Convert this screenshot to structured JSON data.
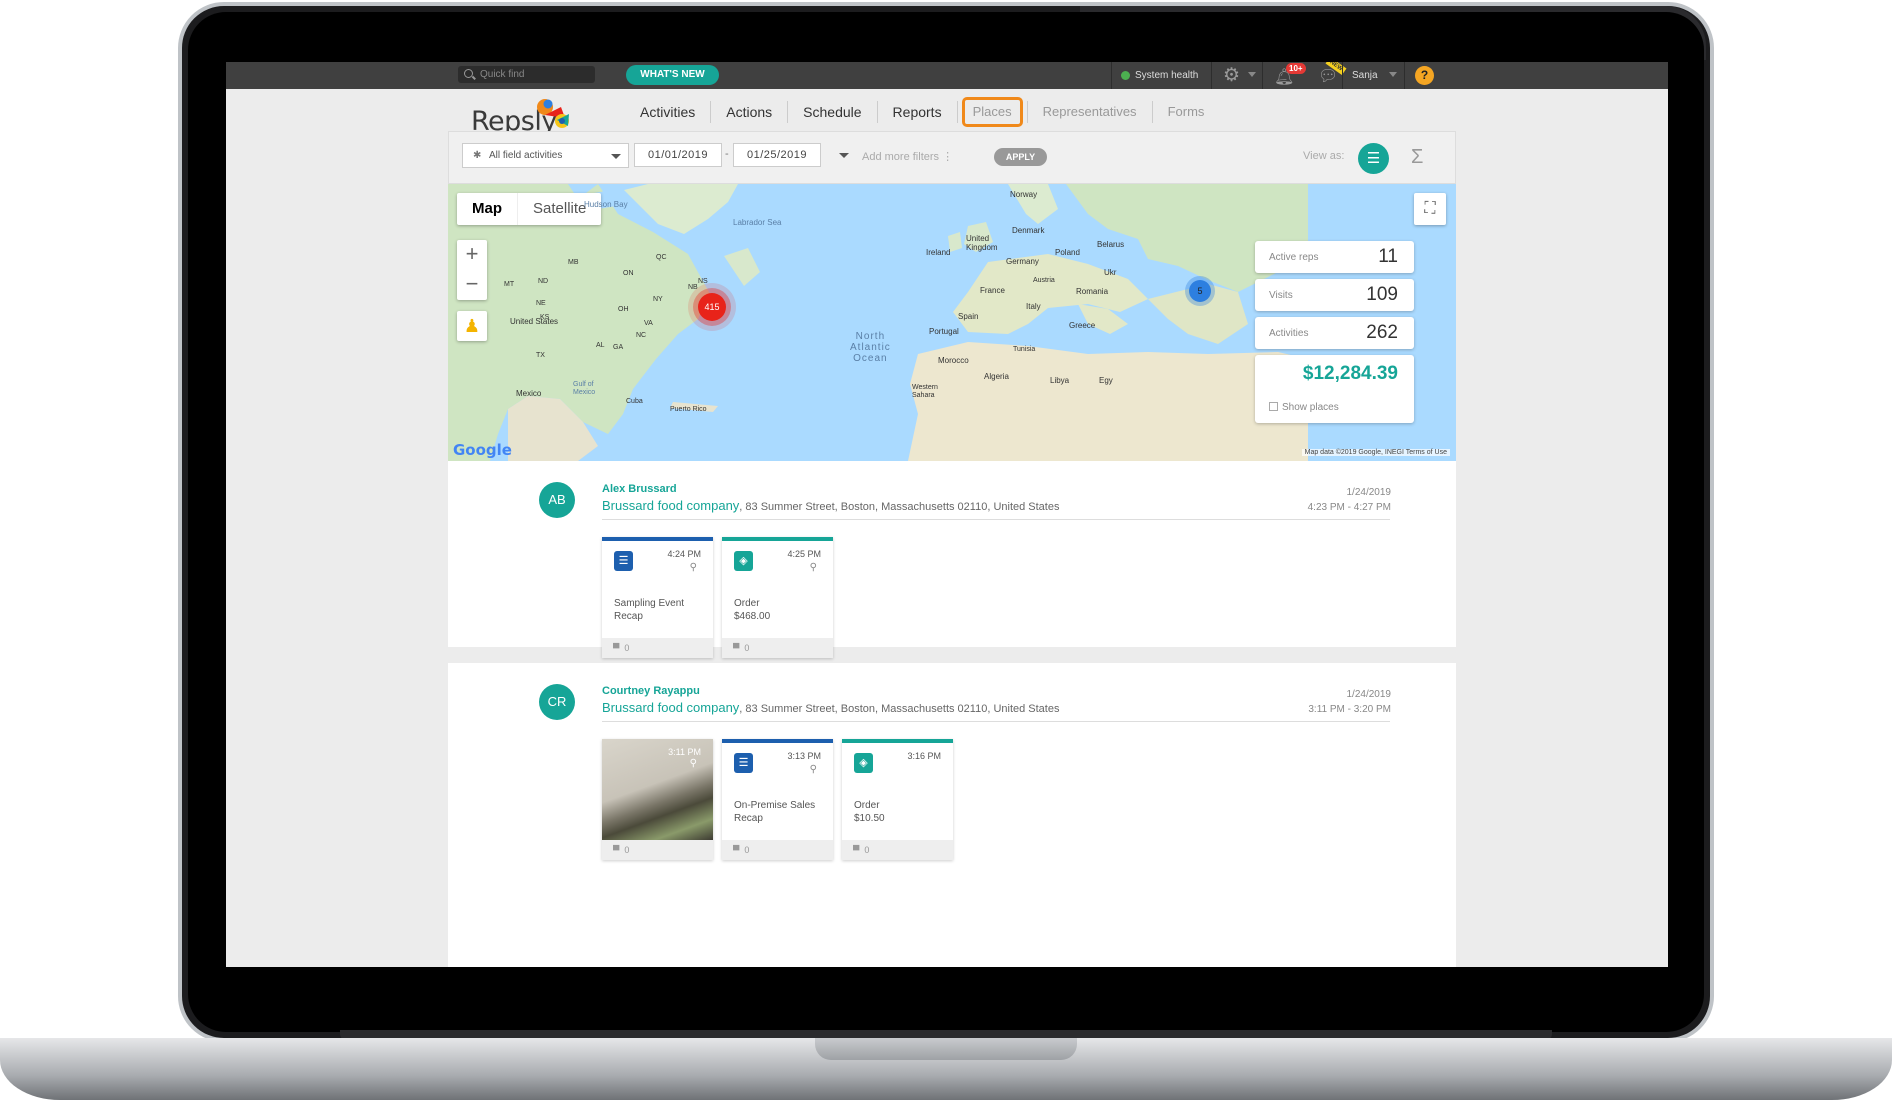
{
  "topbar": {
    "quick_find_placeholder": "Quick find",
    "whats_new": "WHAT'S NEW",
    "system_health": "System health",
    "notifications_badge": "10+",
    "new_tag": "NEW",
    "user_name": "Sanja",
    "help_label": "?"
  },
  "logo": {
    "text": "Repsly"
  },
  "nav": {
    "items": [
      "Activities",
      "Actions",
      "Schedule",
      "Reports",
      "Places",
      "Representatives",
      "Forms"
    ]
  },
  "filters": {
    "activity_type": "All field activities",
    "date_from": "01/01/2019",
    "date_separator": "-",
    "date_to": "01/25/2019",
    "add_more_filters": "Add more filters",
    "apply": "APPLY",
    "view_as": "View as:"
  },
  "map": {
    "type_map": "Map",
    "type_satellite": "Satellite",
    "ocean_label": "North\nAtlantic\nOcean",
    "cluster_us": "415",
    "cluster_eu": "5",
    "google": "Google",
    "attribution": "Map data ©2019 Google, INEGI   Terms of Use",
    "labels": {
      "hudson": "Hudson Bay",
      "labrador": "Labrador Sea",
      "norway": "Norway",
      "denmark": "Denmark",
      "uk": "United Kingdom",
      "ireland": "Ireland",
      "germany": "Germany",
      "poland": "Poland",
      "belarus": "Belarus",
      "ukr": "Ukr",
      "france": "France",
      "austria": "Austria",
      "romania": "Romania",
      "italy": "Italy",
      "spain": "Spain",
      "portugal": "Portugal",
      "greece": "Greece",
      "tunisia": "Tunisia",
      "morocco": "Morocco",
      "algeria": "Algeria",
      "libya": "Libya",
      "egypt": "Egy",
      "western_sahara": "Western Sahara",
      "us": "United States",
      "mexico": "Mexico",
      "gulf": "Gulf of Mexico",
      "cuba": "Cuba",
      "puerto_rico": "Puerto Rico",
      "qc": "QC",
      "on": "ON",
      "mb": "MB",
      "nd": "ND",
      "mt": "MT",
      "ne": "NE",
      "ks": "KS",
      "oh": "OH",
      "ns": "NS",
      "nb": "NB",
      "ny": "NY",
      "nc": "NC",
      "va": "VA",
      "tx": "TX",
      "al": "AL",
      "ga": "GA"
    }
  },
  "stats": {
    "active_reps_label": "Active reps",
    "active_reps": "11",
    "visits_label": "Visits",
    "visits": "109",
    "activities_label": "Activities",
    "activities": "262",
    "revenue": "$12,284.39",
    "show_places": "Show places"
  },
  "activities": [
    {
      "initials": "AB",
      "name": "Alex Brussard",
      "place": "Brussard food company",
      "address": ", 83 Summer Street, Boston, Massachusetts 02110, United States",
      "date": "1/24/2019",
      "time_range": "4:23 PM - 4:27 PM",
      "tiles": [
        {
          "time": "4:24 PM",
          "line1": "Sampling Event",
          "line2": "Recap",
          "comments": "0"
        },
        {
          "time": "4:25 PM",
          "line1": "Order",
          "line2": "$468.00",
          "comments": "0"
        }
      ]
    },
    {
      "initials": "CR",
      "name": "Courtney Rayappu",
      "place": "Brussard food company",
      "address": ", 83 Summer Street, Boston, Massachusetts 02110, United States",
      "date": "1/24/2019",
      "time_range": "3:11 PM - 3:20 PM",
      "tiles": [
        {
          "time": "3:11 PM",
          "comments": "0"
        },
        {
          "time": "3:13 PM",
          "line1": "On-Premise Sales",
          "line2": "Recap",
          "comments": "0"
        },
        {
          "time": "3:16 PM",
          "line1": "Order",
          "line2": "$10.50",
          "comments": "0"
        }
      ]
    }
  ],
  "colors": {
    "accent": "#16a597",
    "highlight": "#f0891a",
    "form_blue": "#1d5fae",
    "cluster_red": "#e8231a",
    "cluster_blue": "#2d7fe0"
  }
}
